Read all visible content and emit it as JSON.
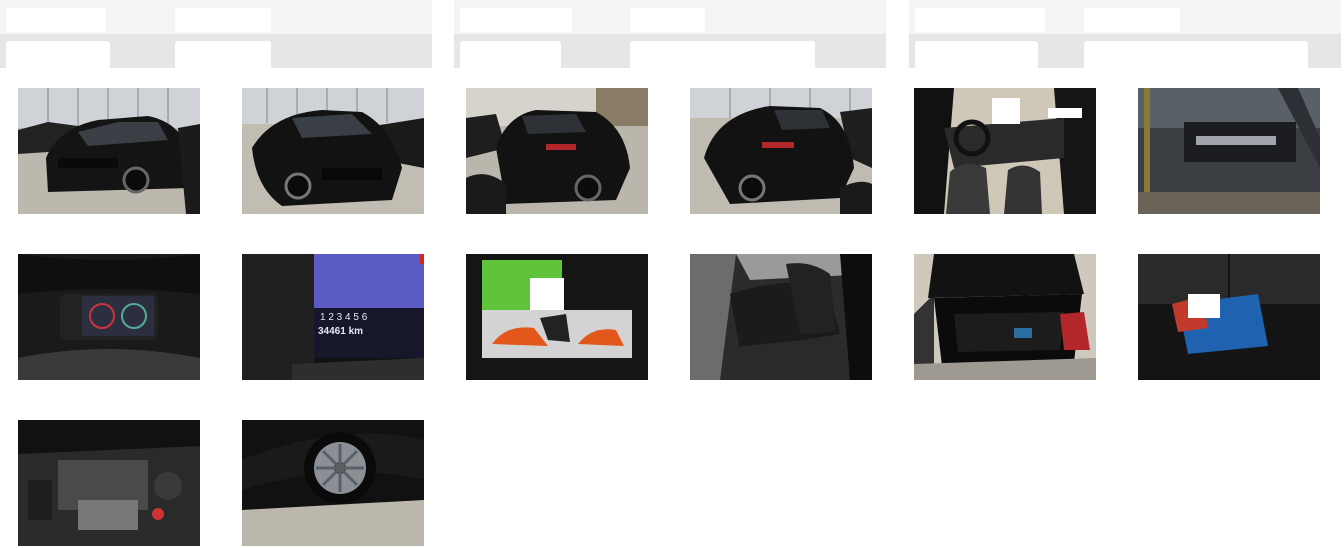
{
  "photos": [
    {
      "id": 1,
      "name": "car-front-left-view"
    },
    {
      "id": 2,
      "name": "car-front-right-view"
    },
    {
      "id": 3,
      "name": "car-rear-left-view"
    },
    {
      "id": 4,
      "name": "car-rear-right-view"
    },
    {
      "id": 5,
      "name": "car-interior-driver-seat"
    },
    {
      "id": 6,
      "name": "windshield-vin-plate"
    },
    {
      "id": 7,
      "name": "instrument-cluster"
    },
    {
      "id": 8,
      "name": "odometer-display"
    },
    {
      "id": 9,
      "name": "owner-manual-and-key"
    },
    {
      "id": 10,
      "name": "rear-seats"
    },
    {
      "id": 11,
      "name": "open-trunk"
    },
    {
      "id": 12,
      "name": "trunk-accessories"
    },
    {
      "id": 13,
      "name": "engine-bay"
    },
    {
      "id": 14,
      "name": "wheel-rim"
    }
  ],
  "odometer": {
    "gears": "1   2   3   4   5   6",
    "reading": "34461 km"
  },
  "colors": {
    "header_bg": "#f4f4f4",
    "header_band": "#e6e6e6",
    "car_paint": "#141414",
    "warehouse_floor": "#bdb8ae",
    "accent_taillight": "#b3262a"
  }
}
